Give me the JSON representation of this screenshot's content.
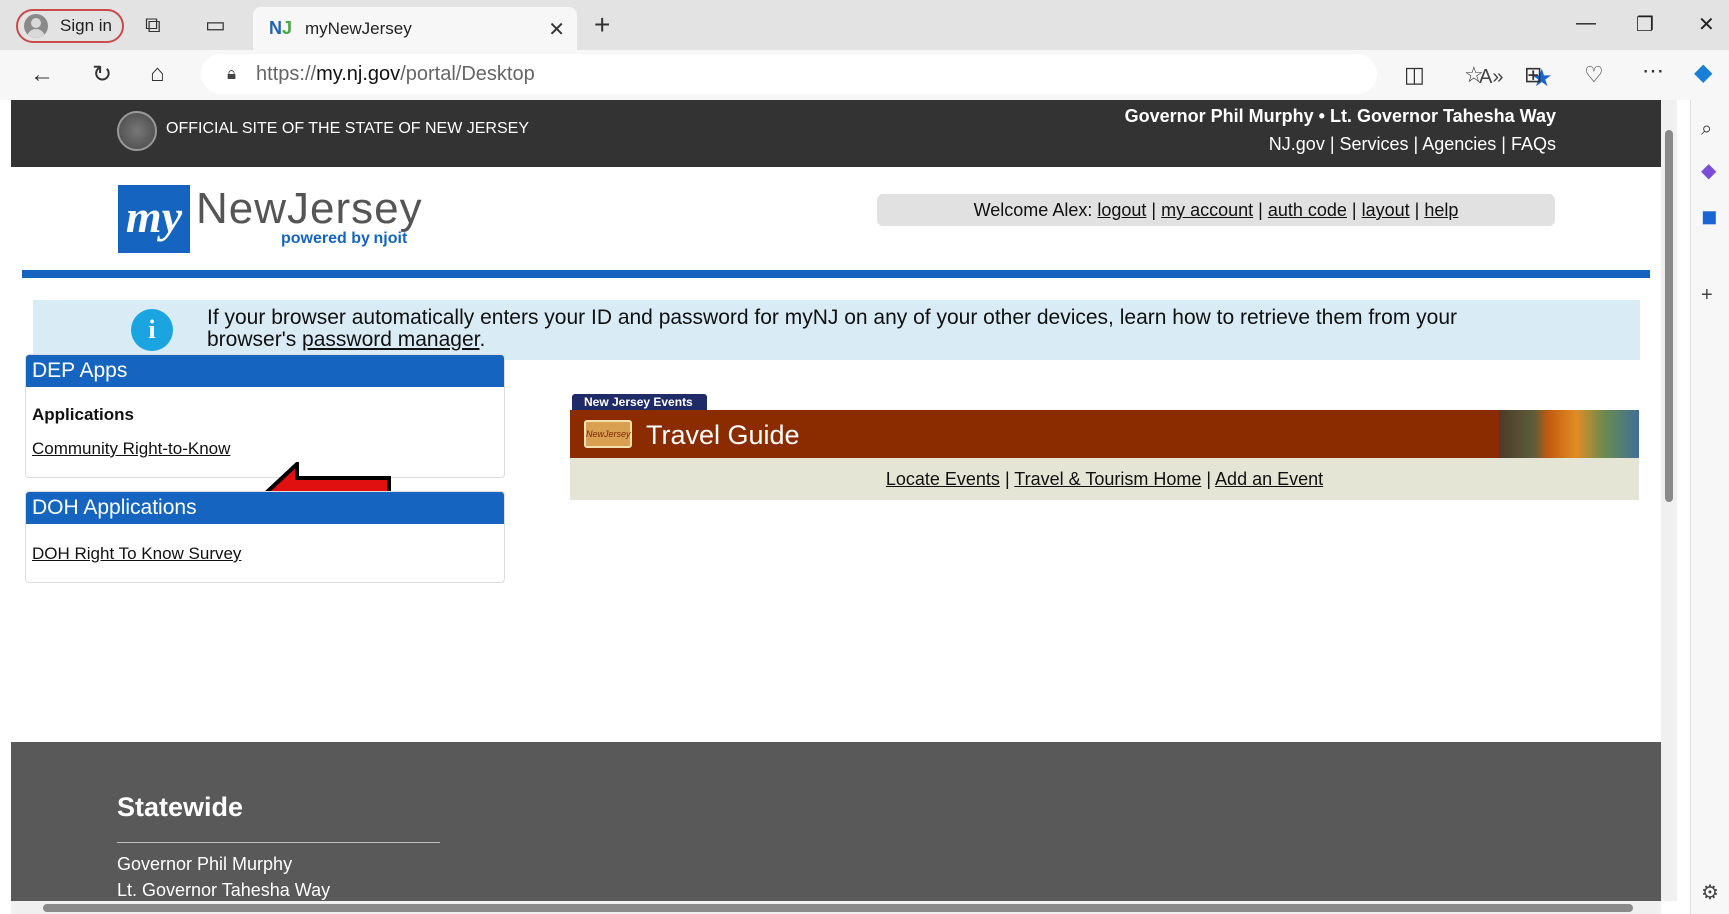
{
  "browser": {
    "signin_label": "Sign in",
    "tab_title": "myNewJersey",
    "url_prefix": "https://",
    "url_host": "my.nj.gov",
    "url_path": "/portal/Desktop"
  },
  "header": {
    "official": "OFFICIAL SITE OF THE STATE OF NEW JERSEY",
    "governors": "Governor Phil Murphy • Lt. Governor Tahesha Way",
    "links": [
      "NJ.gov",
      "Services",
      "Agencies",
      "FAQs"
    ]
  },
  "logo": {
    "my": "my",
    "name": "NewJersey",
    "powered": "powered by",
    "brand": "njoit"
  },
  "welcome": {
    "prefix": "Welcome Alex:",
    "links": [
      "logout",
      "my account",
      "auth code",
      "layout",
      "help"
    ]
  },
  "info": {
    "text": "If your browser automatically enters your ID and password for myNJ on any of your other devices, learn how to retrieve them from your browser's",
    "link": "password manager",
    "suffix": "."
  },
  "dep_panel": {
    "title": "DEP Apps",
    "subtitle": "Applications",
    "link": "Community Right-to-Know"
  },
  "doh_panel": {
    "title": "DOH Applications",
    "link": "DOH Right To Know Survey"
  },
  "events": {
    "tag": "New Jersey Events",
    "title": "Travel Guide",
    "badge": "NewJersey",
    "links": [
      "Locate Events",
      "Travel & Tourism Home",
      "Add an Event"
    ]
  },
  "footer": {
    "title": "Statewide",
    "items": [
      "Governor Phil Murphy",
      "Lt. Governor Tahesha Way"
    ]
  }
}
